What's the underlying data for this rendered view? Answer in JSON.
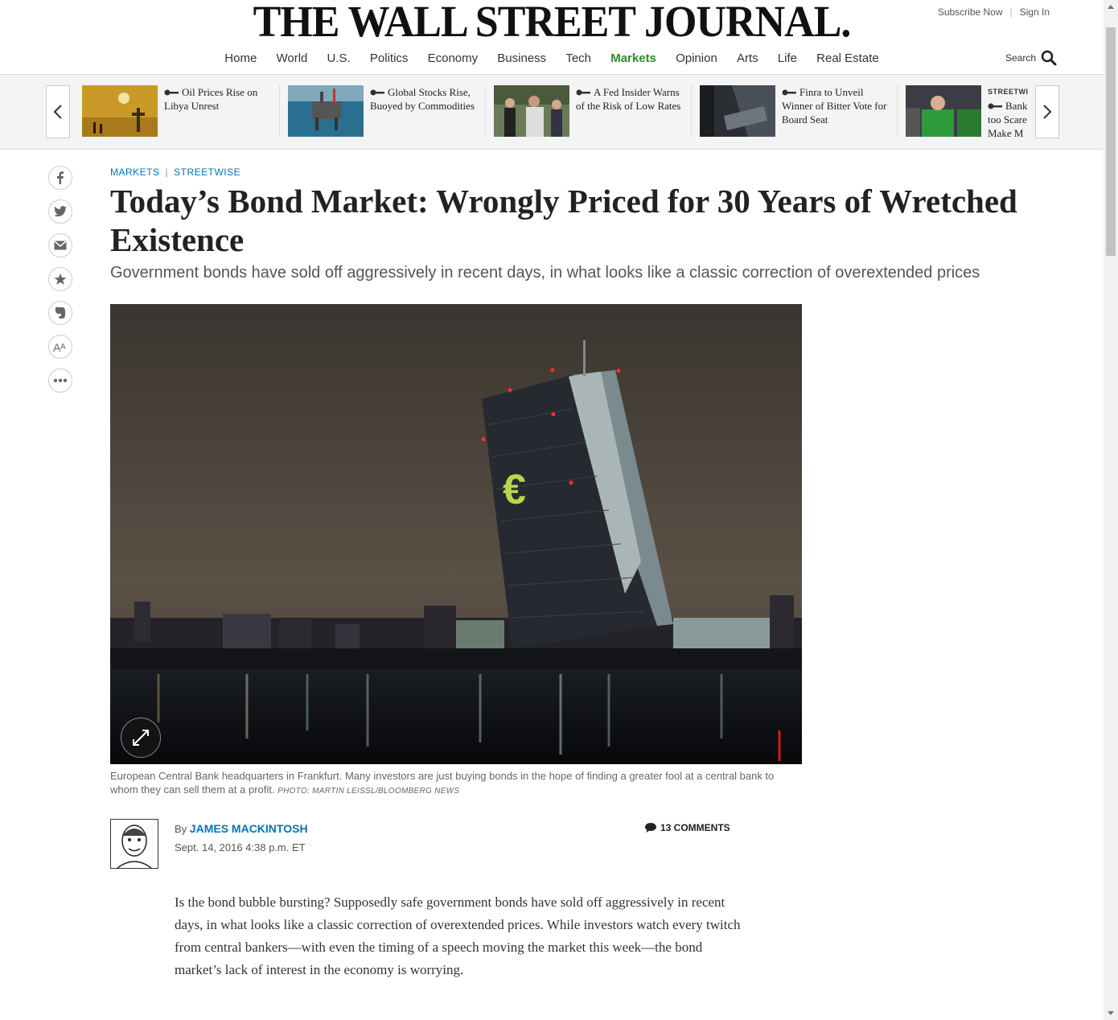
{
  "header": {
    "logo": "THE WALL STREET JOURNAL.",
    "subscribe": "Subscribe Now",
    "signin": "Sign In",
    "search_label": "Search",
    "nav": [
      "Home",
      "World",
      "U.S.",
      "Politics",
      "Economy",
      "Business",
      "Tech",
      "Markets",
      "Opinion",
      "Arts",
      "Life",
      "Real Estate"
    ],
    "active_nav": "Markets",
    "active_color": "#2f8a2f"
  },
  "ticker": {
    "items": [
      {
        "title": "Oil Prices Rise on Libya Unrest",
        "tag": ""
      },
      {
        "title": "Global Stocks Rise, Buoyed by Commodities",
        "tag": ""
      },
      {
        "title": "A Fed Insider Warns of the Risk of Low Rates",
        "tag": ""
      },
      {
        "title": "Finra to Unveil Winner of Bitter Vote for Board Seat",
        "tag": ""
      },
      {
        "title": "Bank too Scare Make M",
        "tag": "STREETWI"
      }
    ]
  },
  "share_icons": [
    "facebook-icon",
    "twitter-icon",
    "email-icon",
    "star-icon",
    "evernote-icon",
    "text-size-icon",
    "more-icon"
  ],
  "article": {
    "kicker_section": "MARKETS",
    "kicker_column": "STREETWISE",
    "headline": "Today’s Bond Market: Wrongly Priced for 30 Years of Wretched Existence",
    "dek": "Government bonds have sold off aggressively in recent days, in what looks like a classic correction of overextended prices",
    "caption": "European Central Bank headquarters in Frankfurt. Many investors are just buying bonds in the hope of finding a greater fool at a central bank to whom they can sell them at a profit.",
    "credit": "PHOTO: MARTIN LEISSL/BLOOMBERG NEWS",
    "by": "By",
    "author": "JAMES MACKINTOSH",
    "date": "Sept. 14, 2016 4:38 p.m. ET",
    "comments": "13 COMMENTS",
    "body": "Is the bond bubble bursting? Supposedly safe government bonds have sold off aggressively in recent days, in what looks like a classic correction of overextended prices. While investors watch every twitch from central bankers—with even the timing of a speech moving the market this week—the bond market’s lack of interest in the economy is worrying."
  },
  "colors": {
    "link_blue": "#0274b6"
  }
}
